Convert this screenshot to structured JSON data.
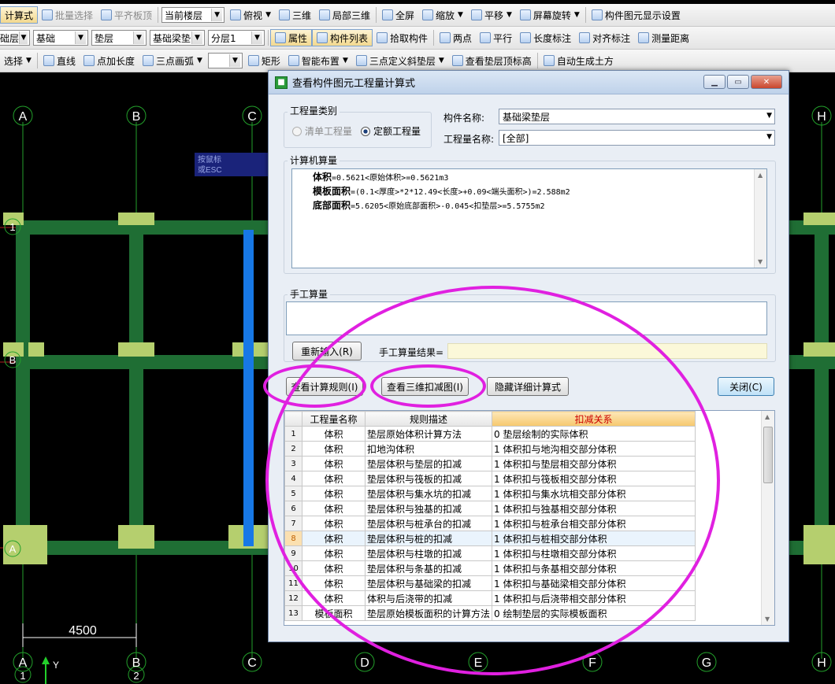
{
  "toolbar1": {
    "items": [
      "计算式",
      "批量选择",
      "平齐板顶",
      "当前楼层",
      "俯视",
      "三维",
      "局部三维",
      "全屏",
      "缩放",
      "平移",
      "屏幕旋转",
      "构件图元显示设置"
    ]
  },
  "toolbar2": {
    "combo1": "础层",
    "combo2": "基础",
    "combo3": "垫层",
    "combo4": "基础梁垫",
    "combo5": "分层1",
    "items": [
      "属性",
      "构件列表",
      "拾取构件",
      "两点",
      "平行",
      "长度标注",
      "对齐标注",
      "测量距离"
    ]
  },
  "toolbar3": {
    "items": [
      "选择",
      "直线",
      "点加长度",
      "三点画弧",
      "矩形",
      "智能布置",
      "三点定义斜垫层",
      "查看垫层顶标高",
      "自动生成土方"
    ]
  },
  "canvas": {
    "axes_top": [
      "A",
      "B",
      "C",
      "H"
    ],
    "axes_bottom": [
      "A",
      "B",
      "C",
      "D",
      "E",
      "F",
      "G",
      "H"
    ],
    "axes_bottom_sub": [
      "1",
      "2"
    ],
    "rows": [
      "1",
      "B",
      "A"
    ],
    "dimension": "4500",
    "tooltip_lines": [
      "按鼠标",
      "或ESC"
    ],
    "ucs_label": "Y"
  },
  "dialog": {
    "title": "查看构件图元工程量计算式",
    "qty_type_label": "工程量类别",
    "radio_list": "清单工程量",
    "radio_quota": "定额工程量",
    "component_name_label": "构件名称:",
    "component_name_value": "基础梁垫层",
    "qty_name_label": "工程量名称:",
    "qty_name_value": "[全部]",
    "computer_calc_label": "计算机算量",
    "calc_lines": [
      {
        "key": "体积",
        "expr": "=0.5621<原始体积>=0.5621m3"
      },
      {
        "key": "模板面积",
        "expr": "=(0.1<厚度>*2*12.49<长度>+0.09<端头面积>)=2.588m2"
      },
      {
        "key": "底部面积",
        "expr": "=5.6205<原始底部面积>-0.045<扣垫层>=5.5755m2"
      }
    ],
    "manual_calc_label": "手工算量",
    "reinput_button": "重新输入(R)",
    "manual_result_label": "手工算量结果=",
    "view_rules_button": "查看计算规则(I)",
    "view_3d_button": "查看三维扣减图(I)",
    "hide_detail_button": "隐藏详细计算式",
    "close_button": "关闭(C)",
    "table": {
      "headers": [
        "工程量名称",
        "规则描述",
        "扣减关系"
      ],
      "rows": [
        [
          "1",
          "体积",
          "垫层原始体积计算方法",
          "0 垫层绘制的实际体积"
        ],
        [
          "2",
          "体积",
          "扣地沟体积",
          "1 体积扣与地沟相交部分体积"
        ],
        [
          "3",
          "体积",
          "垫层体积与垫层的扣减",
          "1 体积扣与垫层相交部分体积"
        ],
        [
          "4",
          "体积",
          "垫层体积与筏板的扣减",
          "1 体积扣与筏板相交部分体积"
        ],
        [
          "5",
          "体积",
          "垫层体积与集水坑的扣减",
          "1 体积扣与集水坑相交部分体积"
        ],
        [
          "6",
          "体积",
          "垫层体积与独基的扣减",
          "1 体积扣与独基相交部分体积"
        ],
        [
          "7",
          "体积",
          "垫层体积与桩承台的扣减",
          "1 体积扣与桩承台相交部分体积"
        ],
        [
          "8",
          "体积",
          "垫层体积与桩的扣减",
          "1 体积扣与桩相交部分体积"
        ],
        [
          "9",
          "体积",
          "垫层体积与柱墩的扣减",
          "1 体积扣与柱墩相交部分体积"
        ],
        [
          "10",
          "体积",
          "垫层体积与条基的扣减",
          "1 体积扣与条基相交部分体积"
        ],
        [
          "11",
          "体积",
          "垫层体积与基础梁的扣减",
          "1 体积扣与基础梁相交部分体积"
        ],
        [
          "12",
          "体积",
          "体积与后浇带的扣减",
          "1 体积扣与后浇带相交部分体积"
        ],
        [
          "13",
          "模板面积",
          "垫层原始模板面积的计算方法",
          "0 绘制垫层的实际模板面积"
        ]
      ]
    }
  },
  "colors": {
    "annotation": "#e020e0",
    "beam": "#1f6e34",
    "pad": "#b5cf6e",
    "selected": "#1778e6",
    "axis": "#23a02b"
  }
}
